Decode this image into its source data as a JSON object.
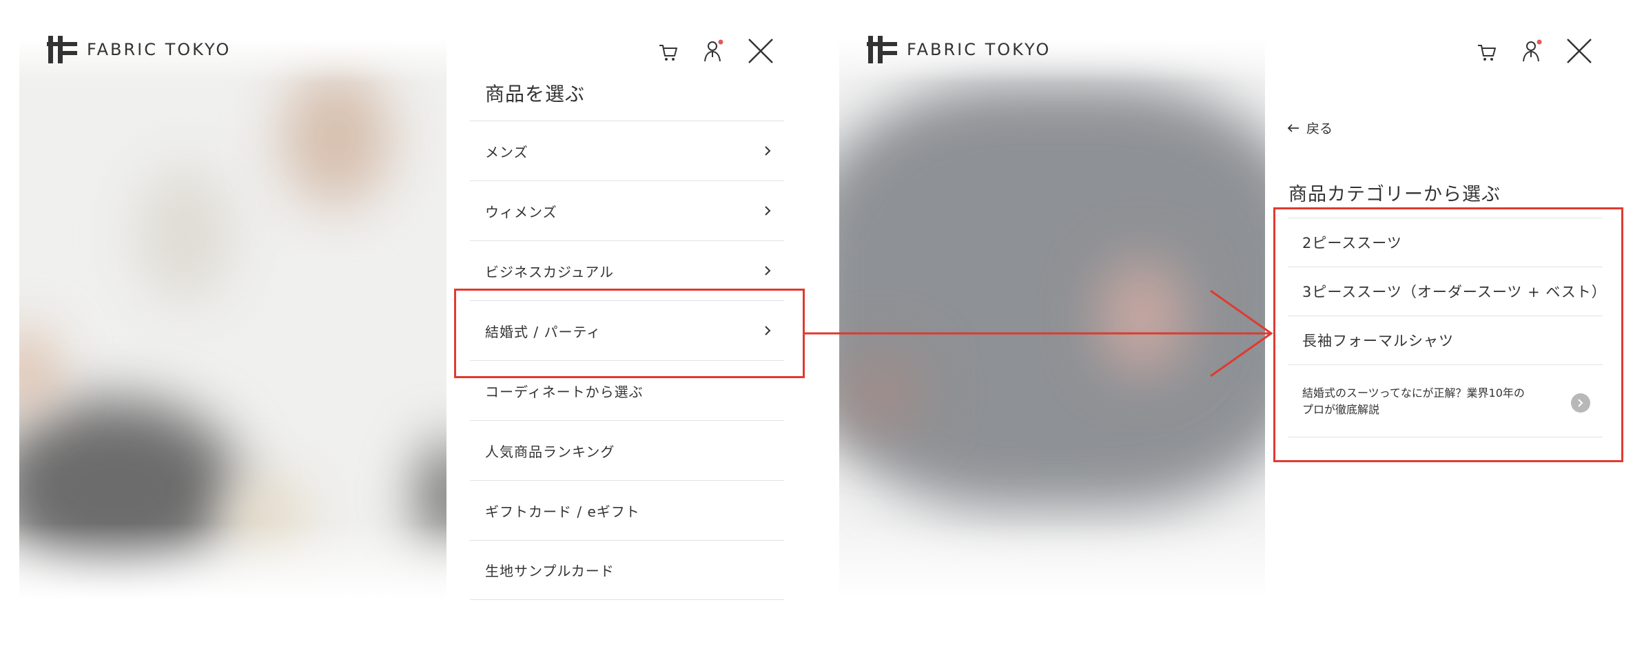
{
  "brand": {
    "name": "FABRIC TOKYO"
  },
  "menu": {
    "title": "商品を選ぶ",
    "items": [
      {
        "label": "メンズ",
        "has_arrow": true
      },
      {
        "label": "ウィメンズ",
        "has_arrow": true
      },
      {
        "label": "ビジネスカジュアル",
        "has_arrow": true
      },
      {
        "label": "結婚式 / パーティ",
        "has_arrow": true
      },
      {
        "label": "コーディネートから選ぶ",
        "has_arrow": false
      },
      {
        "label": "人気商品ランキング",
        "has_arrow": false
      },
      {
        "label": "ギフトカード / eギフト",
        "has_arrow": false
      },
      {
        "label": "生地サンプルカード",
        "has_arrow": false
      }
    ]
  },
  "submenu": {
    "back_label": "戻る",
    "title": "商品カテゴリーから選ぶ",
    "items": [
      {
        "label": "2ピーススーツ"
      },
      {
        "label": "3ピーススーツ（オーダースーツ + ベスト）"
      },
      {
        "label": "長袖フォーマルシャツ"
      }
    ],
    "article": {
      "line1": "結婚式のスーツってなにが正解？業界10年の",
      "line2": "プロが徹底解説"
    }
  },
  "icons": {
    "cart": "cart-icon",
    "account": "account-icon",
    "close": "close-icon",
    "chevron": "chevron-right-icon",
    "back": "arrow-left-icon"
  },
  "colors": {
    "text": "#333333",
    "divider": "#e1e1e1",
    "notification_dot": "#e05a5a",
    "annotation": "#e03a2f",
    "article_button": "#b8b8b8"
  }
}
